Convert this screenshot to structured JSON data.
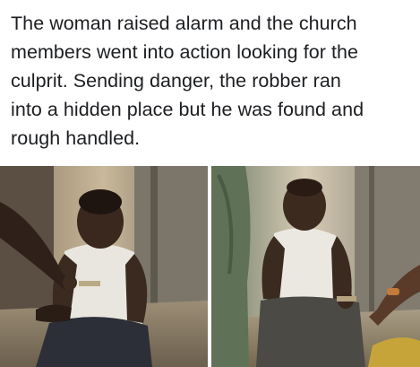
{
  "post": {
    "caption_lines": [
      "The woman raised alarm and the church",
      "members went into action looking for the",
      "culprit. Sending danger, the robber ran",
      "into a hidden place but he was found and",
      "rough handled."
    ]
  },
  "photos": [
    {
      "subject": "man-seated-on-floor-being-restrained"
    },
    {
      "subject": "man-seated-in-corner-with-bound-wrists"
    }
  ]
}
